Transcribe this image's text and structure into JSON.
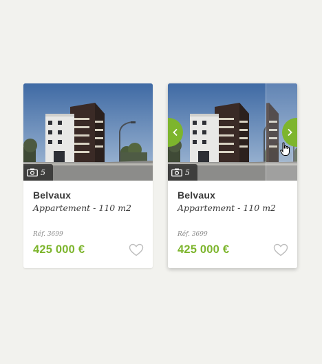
{
  "listings": [
    {
      "photo_count": "5",
      "city": "Belvaux",
      "type": "Appartement -  110 m2",
      "ref": "Réf. 3699",
      "price": "425 000 €",
      "hovered": false
    },
    {
      "photo_count": "5",
      "city": "Belvaux",
      "type": "Appartement -  110 m2",
      "ref": "Réf. 3699",
      "price": "425 000 €",
      "hovered": true
    }
  ],
  "icons": {
    "photo_count": "camera-icon",
    "favorite": "heart-outline-icon",
    "previous": "chevron-left-icon",
    "next": "chevron-right-icon",
    "cursor": "hand-pointer-icon"
  },
  "colors": {
    "accent": "#7db52d",
    "background": "#f2f2ee",
    "card": "#ffffff",
    "text": "#3a3a3a",
    "muted": "#8a8a8a"
  }
}
